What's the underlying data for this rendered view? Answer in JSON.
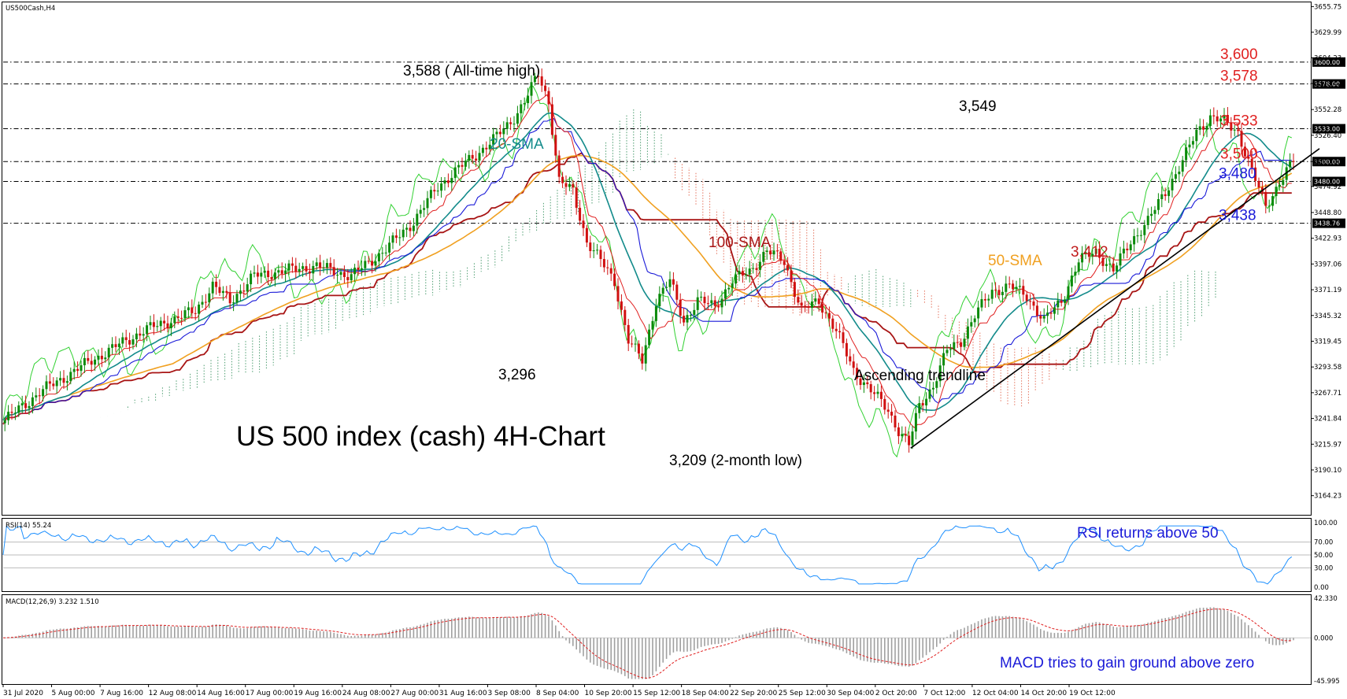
{
  "chart_data": {
    "type": "candlestick",
    "symbol_label": "US500Cash,H4",
    "title": "US 500 index (cash) 4H-Chart",
    "price_axis": {
      "min": 3145,
      "max": 3660,
      "ticks": [
        "3655.75",
        "3629.99",
        "3604.23",
        "3578.47",
        "3552.28",
        "3526.40",
        "3500.00",
        "3474.92",
        "3448.80",
        "3422.93",
        "3397.06",
        "3371.19",
        "3345.32",
        "3319.45",
        "3293.58",
        "3267.71",
        "3241.84",
        "3215.97",
        "3190.10",
        "3164.23"
      ]
    },
    "x_labels": [
      "31 Jul 2020",
      "5 Aug 00:00",
      "7 Aug 16:00",
      "12 Aug 08:00",
      "14 Aug 16:00",
      "17 Aug 00:00",
      "19 Aug 16:00",
      "24 Aug 08:00",
      "27 Aug 00:00",
      "31 Aug 16:00",
      "3 Sep 08:00",
      "8 Sep 04:00",
      "10 Sep 20:00",
      "15 Sep 12:00",
      "18 Sep 04:00",
      "22 Sep 20:00",
      "25 Sep 12:00",
      "30 Sep 04:00",
      "2 Oct 20:00",
      "7 Oct 12:00",
      "12 Oct 04:00",
      "14 Oct 20:00",
      "19 Oct 12:00"
    ],
    "close_path": [
      [
        0,
        3240
      ],
      [
        10,
        3268
      ],
      [
        25,
        3300
      ],
      [
        40,
        3330
      ],
      [
        55,
        3350
      ],
      [
        60,
        3375
      ],
      [
        65,
        3360
      ],
      [
        72,
        3385
      ],
      [
        80,
        3390
      ],
      [
        90,
        3395
      ],
      [
        100,
        3385
      ],
      [
        110,
        3412
      ],
      [
        118,
        3440
      ],
      [
        125,
        3475
      ],
      [
        130,
        3490
      ],
      [
        137,
        3510
      ],
      [
        142,
        3525
      ],
      [
        146,
        3540
      ],
      [
        150,
        3560
      ],
      [
        154,
        3588
      ],
      [
        157,
        3560
      ],
      [
        160,
        3480
      ],
      [
        164,
        3470
      ],
      [
        168,
        3420
      ],
      [
        172,
        3400
      ],
      [
        176,
        3380
      ],
      [
        180,
        3320
      ],
      [
        184,
        3300
      ],
      [
        188,
        3360
      ],
      [
        192,
        3380
      ],
      [
        196,
        3340
      ],
      [
        200,
        3360
      ],
      [
        205,
        3355
      ],
      [
        210,
        3380
      ],
      [
        215,
        3390
      ],
      [
        220,
        3410
      ],
      [
        225,
        3400
      ],
      [
        230,
        3350
      ],
      [
        235,
        3360
      ],
      [
        240,
        3330
      ],
      [
        245,
        3290
      ],
      [
        250,
        3270
      ],
      [
        255,
        3250
      ],
      [
        258,
        3230
      ],
      [
        261,
        3215
      ],
      [
        264,
        3255
      ],
      [
        268,
        3275
      ],
      [
        272,
        3310
      ],
      [
        276,
        3320
      ],
      [
        280,
        3345
      ],
      [
        285,
        3370
      ],
      [
        290,
        3375
      ],
      [
        295,
        3365
      ],
      [
        300,
        3340
      ],
      [
        305,
        3360
      ],
      [
        310,
        3400
      ],
      [
        315,
        3410
      ],
      [
        320,
        3390
      ],
      [
        325,
        3420
      ],
      [
        330,
        3440
      ],
      [
        335,
        3470
      ],
      [
        340,
        3500
      ],
      [
        344,
        3530
      ],
      [
        348,
        3545
      ],
      [
        352,
        3540
      ],
      [
        356,
        3530
      ],
      [
        360,
        3490
      ],
      [
        364,
        3455
      ],
      [
        368,
        3480
      ],
      [
        372,
        3500
      ]
    ],
    "moving_averages": [
      {
        "name": "20-SMA",
        "period": 20,
        "color": "#138b8b"
      },
      {
        "name": "50-SMA",
        "period": 50,
        "color": "#f0a020"
      },
      {
        "name": "100-SMA",
        "period": 100,
        "color": "#a81515"
      }
    ],
    "levels": [
      {
        "value": 3600,
        "label": "3,600",
        "color": "#e02020",
        "axis": "3600.00"
      },
      {
        "value": 3578,
        "label": "3,578",
        "color": "#e02020",
        "axis": "3578.00"
      },
      {
        "value": 3533,
        "label": "3,533",
        "color": "#e02020",
        "axis": "3533.00"
      },
      {
        "value": 3500,
        "label": "3,500",
        "color": "#e02020",
        "axis": "3500.00"
      },
      {
        "value": 3480,
        "label": "3,480",
        "color": "#1a1ad8",
        "axis": "3480.00"
      },
      {
        "value": 3438,
        "label": "3,438",
        "color": "#1a1ad8",
        "axis": "3438.76"
      }
    ],
    "annotations": [
      {
        "text": "3,588 ( All-time high)",
        "color": "#000000"
      },
      {
        "text": "3,296",
        "color": "#000000"
      },
      {
        "text": "3,209 (2-month low)",
        "color": "#000000"
      },
      {
        "text": "3,549",
        "color": "#000000"
      },
      {
        "text": "20-SMA",
        "color": "#138b8b"
      },
      {
        "text": "100-SMA",
        "color": "#a81515"
      },
      {
        "text": "50-SMA",
        "color": "#f0a020"
      },
      {
        "text": "3,412",
        "color": "#c01c1c"
      },
      {
        "text": "Ascending trendline",
        "color": "#000000"
      }
    ],
    "trendline": {
      "start": [
        262,
        3212
      ],
      "end": [
        380,
        3513
      ]
    },
    "rsi": {
      "label": "RSI(14) 55.24",
      "ticks": [
        "100.00",
        "70.00",
        "50.00",
        "30.00",
        "0.00"
      ],
      "annotation": "RSI returns above 50",
      "annotation_color": "#1a1ad8"
    },
    "macd": {
      "label": "MACD(12,26,9) 3.232 1.510",
      "ticks": [
        "42.330",
        "0.000",
        "-45.995"
      ],
      "annotation": "MACD tries to gain ground above zero",
      "annotation_color": "#1a1ad8"
    }
  }
}
